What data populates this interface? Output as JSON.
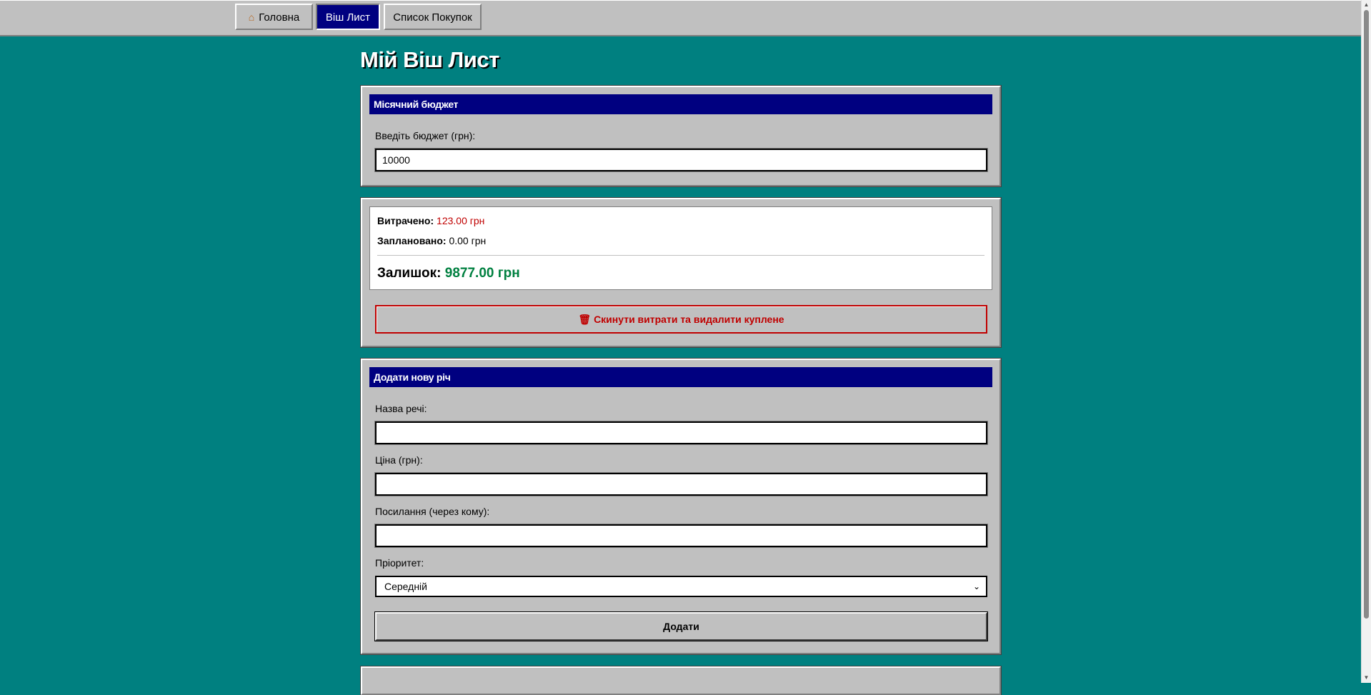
{
  "nav": {
    "tabs": [
      {
        "label": "Головна",
        "icon": "house-icon",
        "active": false
      },
      {
        "label": "Віш Лист",
        "active": true
      },
      {
        "label": "Список Покупок",
        "active": false
      }
    ]
  },
  "page": {
    "title": "Мій Віш Лист"
  },
  "budget_panel": {
    "header": "Місячний бюджет",
    "label": "Введіть бюджет (грн):",
    "value": "10000"
  },
  "summary": {
    "spent_label": "Витрачено:",
    "spent_value": "123.00 грн",
    "planned_label": "Заплановано:",
    "planned_value": "0.00 грн",
    "remaining_label": "Залишок:",
    "remaining_value": "9877.00 грн",
    "reset_button": "🗑 Скинути витрати та видалити куплене"
  },
  "add_panel": {
    "header": "Додати нову річ",
    "name_label": "Назва речі:",
    "name_value": "",
    "price_label": "Ціна (грн):",
    "price_value": "",
    "link_label": "Посилання (через кому):",
    "link_value": "",
    "priority_label": "Пріоритет:",
    "priority_selected": "Середній",
    "submit_button": "Додати"
  },
  "colors": {
    "background": "#008080",
    "panel": "#c0c0c0",
    "header": "#000080",
    "spent": "#c00000",
    "remaining": "#008040"
  }
}
